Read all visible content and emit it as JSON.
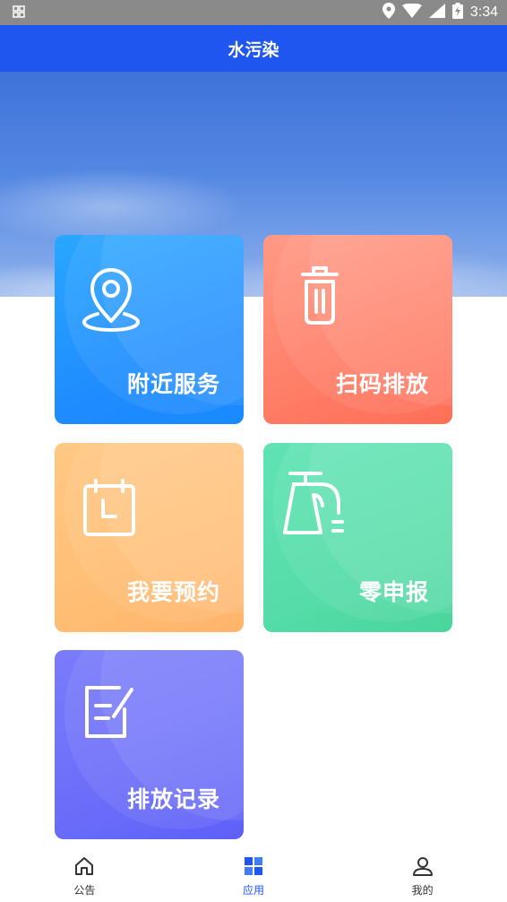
{
  "status_bar": {
    "time": "3:34"
  },
  "app_bar": {
    "title": "水污染"
  },
  "tiles": [
    {
      "label": "附近服务",
      "icon": "location-pin-icon"
    },
    {
      "label": "扫码排放",
      "icon": "trash-can-icon"
    },
    {
      "label": "我要预约",
      "icon": "calendar-icon"
    },
    {
      "label": "零申报",
      "icon": "faucet-icon"
    },
    {
      "label": "排放记录",
      "icon": "edit-document-icon"
    }
  ],
  "bottom_nav": {
    "items": [
      {
        "label": "公告",
        "icon": "home-icon",
        "active": false
      },
      {
        "label": "应用",
        "icon": "grid-icon",
        "active": true
      },
      {
        "label": "我的",
        "icon": "user-icon",
        "active": false
      }
    ]
  },
  "colors": {
    "primary": "#1f56f0",
    "tile_blue": "#1f8bff",
    "tile_red": "#ff7b64",
    "tile_orange": "#ffbd73",
    "tile_green": "#55dca8",
    "tile_purple": "#6a6cf9"
  }
}
